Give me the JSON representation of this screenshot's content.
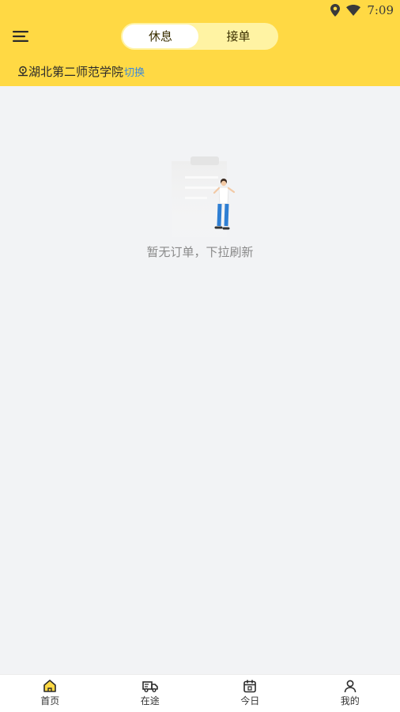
{
  "status_bar": {
    "time": "7:09",
    "icons": [
      "location-icon",
      "wifi-icon"
    ]
  },
  "header": {
    "menu_icon": "menu-icon",
    "mode_toggle": {
      "options": [
        "休息",
        "接单"
      ],
      "selected": "休息"
    },
    "location": {
      "icon": "location-pin-icon",
      "name": "湖北第二师范学院",
      "switch_label": "切换"
    }
  },
  "main": {
    "empty_state": {
      "illustration": "empty-clipboard-illustration",
      "message": "暂无订单，下拉刷新"
    }
  },
  "tab_bar": {
    "items": [
      {
        "label": "首页",
        "icon": "home-icon",
        "active": true
      },
      {
        "label": "在途",
        "icon": "truck-icon",
        "active": false
      },
      {
        "label": "今日",
        "icon": "calendar-icon",
        "active": false
      },
      {
        "label": "我的",
        "icon": "user-icon",
        "active": false
      }
    ]
  },
  "colors": {
    "header_bg": "#ffd944",
    "toggle_bg": "#fff3a3",
    "link": "#3d8ad9",
    "page_bg": "#f2f3f5"
  }
}
